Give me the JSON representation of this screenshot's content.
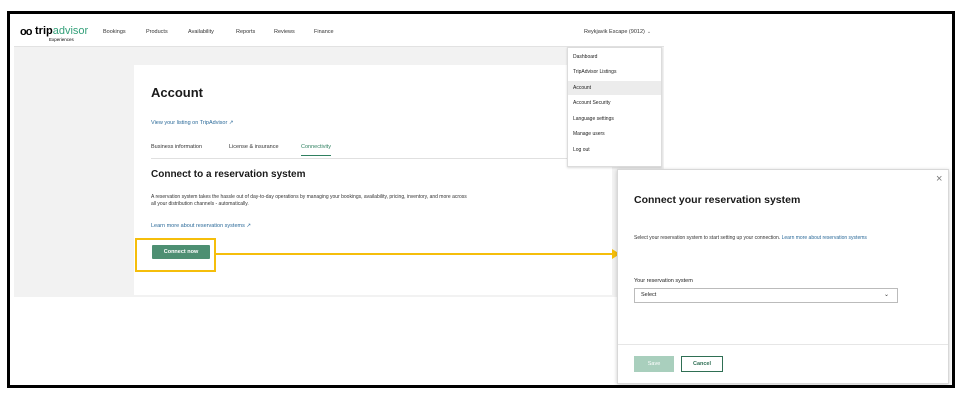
{
  "logo": {
    "owl": "oo",
    "brand_bold": "trip",
    "brand_light": "advisor",
    "sub": "Experiences"
  },
  "nav": {
    "items": [
      "Bookings",
      "Products",
      "Availability",
      "Reports",
      "Reviews",
      "Finance"
    ],
    "account_menu": "Reykjavik Escape (9012)",
    "chevron": "⌄"
  },
  "dropdown": {
    "items": [
      "Dashboard",
      "TripAdvisor Listings",
      "Account",
      "Account Security",
      "Language settings",
      "Manage users",
      "Log out"
    ],
    "active_index": 2
  },
  "page": {
    "title": "Account",
    "view_link": "View your listing on TripAdvisor ↗",
    "tabs": [
      "Business information",
      "License & insurance",
      "Connectivity"
    ],
    "active_tab": "Connectivity",
    "section_title": "Connect to a reservation system",
    "description": "A reservation system takes the hassle out of day-to-day operations by managing your bookings, availability, pricing, inventory, and more across all your distribution channels - automatically.",
    "learn_link": "Learn more about reservation systems ↗",
    "connect_button": "Connect now"
  },
  "modal": {
    "close": "×",
    "title": "Connect your reservation system",
    "description": "Select your reservation system to start setting up your connection.",
    "description_link": "Learn more about reservation systems",
    "field_label": "Your reservation system",
    "select_value": "Select",
    "select_chevron": "⌄",
    "save": "Save",
    "cancel": "Cancel"
  },
  "colors": {
    "accent_green": "#4d8f72",
    "highlight": "#f5be0b",
    "link_blue": "#2b6a99"
  }
}
